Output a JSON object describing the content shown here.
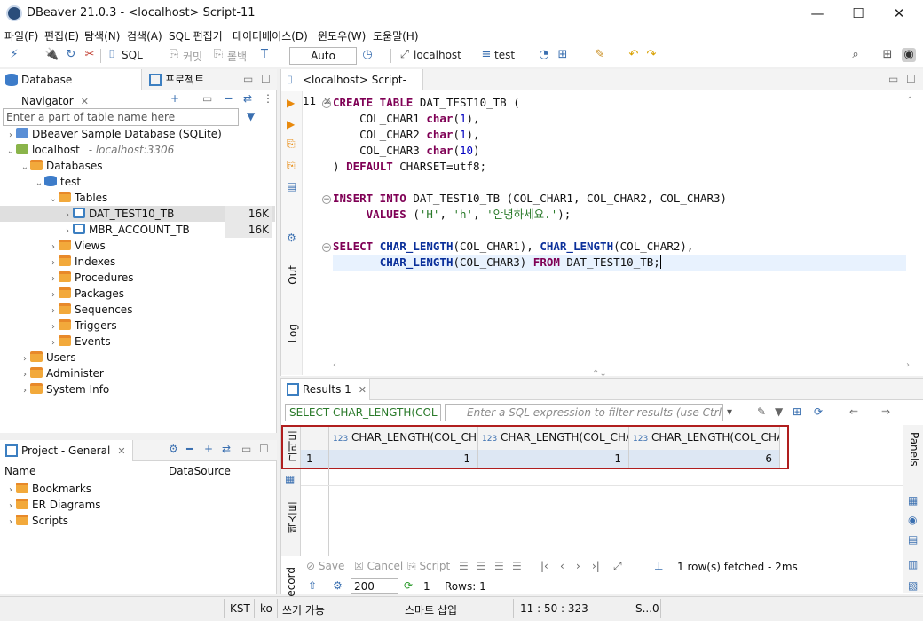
{
  "window": {
    "title": "DBeaver 21.0.3 - <localhost> Script-11",
    "minimize": "—",
    "maximize": "☐",
    "close": "✕"
  },
  "menu": [
    "파일(F)",
    "편집(E)",
    "탐색(N)",
    "검색(A)",
    "SQL 편집기",
    "데이터베이스(D)",
    "윈도우(W)",
    "도움말(H)"
  ],
  "toolbar": {
    "sql": "SQL",
    "commit": "커밋",
    "rollback": "롤백",
    "mode": "Auto",
    "connection": "localhost",
    "schema": "test"
  },
  "navigator": {
    "tab1": "Database Navigator",
    "tab2": "프로젝트",
    "filter_placeholder": "Enter a part of table name here",
    "items": [
      {
        "label": "DBeaver Sample Database (SQLite)"
      },
      {
        "label": "localhost",
        "extra": "- localhost:3306"
      },
      {
        "label": "Databases"
      },
      {
        "label": "test"
      },
      {
        "label": "Tables"
      },
      {
        "label": "DAT_TEST10_TB",
        "size": "16K"
      },
      {
        "label": "MBR_ACCOUNT_TB",
        "size": "16K"
      },
      {
        "label": "Views"
      },
      {
        "label": "Indexes"
      },
      {
        "label": "Procedures"
      },
      {
        "label": "Packages"
      },
      {
        "label": "Sequences"
      },
      {
        "label": "Triggers"
      },
      {
        "label": "Events"
      },
      {
        "label": "Users"
      },
      {
        "label": "Administer"
      },
      {
        "label": "System Info"
      }
    ]
  },
  "project": {
    "title": "Project - General",
    "col_name": "Name",
    "col_ds": "DataSource",
    "items": [
      "Bookmarks",
      "ER Diagrams",
      "Scripts"
    ]
  },
  "editor": {
    "tab": "<localhost> Script-11",
    "side_out": "Out",
    "side_log": "Log"
  },
  "code": {
    "l1a": "CREATE TABLE",
    "l1b": " DAT_TEST10_TB (",
    "l2a": "    COL_CHAR1 ",
    "l2b": "char",
    "l2c": "(",
    "l2d": "1",
    "l2e": "),",
    "l3a": "    COL_CHAR2 ",
    "l3b": "char",
    "l3c": "(",
    "l3d": "1",
    "l3e": "),",
    "l4a": "    COL_CHAR3 ",
    "l4b": "char",
    "l4c": "(",
    "l4d": "10",
    "l4e": ")",
    "l5a": ") ",
    "l5b": "DEFAULT",
    "l5c": " CHARSET=utf8;",
    "l7a": "INSERT INTO",
    "l7b": " DAT_TEST10_TB (COL_CHAR1, COL_CHAR2, COL_CHAR3)",
    "l8a": "     VALUES",
    "l8b": " (",
    "l8c": "'H'",
    "l8d": ", ",
    "l8e": "'h'",
    "l8f": ", ",
    "l8g": "'안녕하세요.'",
    "l8h": ");",
    "l10a": "SELECT",
    "l10b": " ",
    "l10c": "CHAR_LENGTH",
    "l10d": "(COL_CHAR1), ",
    "l10e": "CHAR_LENGTH",
    "l10f": "(COL_CHAR2),",
    "l11a": "       ",
    "l11b": "CHAR_LENGTH",
    "l11c": "(COL_CHAR3) ",
    "l11d": "FROM",
    "l11e": " DAT_TEST10_TB;"
  },
  "results": {
    "tab": "Results 1",
    "query_preview": "SELECT CHAR_LENGTH(COL",
    "filter_placeholder": "Enter a SQL expression to filter results (use Ctrl+S",
    "side_grid": "그리드",
    "side_text": "텍스트",
    "side_record": "ecord",
    "panels": "Panels",
    "columns": [
      "CHAR_LENGTH(COL_CHAR",
      "CHAR_LENGTH(COL_CHAR",
      "CHAR_LENGTH(COL_CHAR"
    ],
    "type_badge": "123",
    "row_num": "1",
    "row_values": [
      "1",
      "1",
      "6"
    ],
    "save": "Save",
    "cancel": "Cancel",
    "script": "Script",
    "fetched": "1 row(s) fetched - 2ms",
    "fetch_size": "200",
    "count": "1",
    "rows": "Rows: 1"
  },
  "status": {
    "tz": "KST",
    "lang": "ko",
    "write": "쓰기 가능",
    "insert": "스마트 삽입",
    "pos": "11 : 50 : 323",
    "sel": "S...0"
  }
}
